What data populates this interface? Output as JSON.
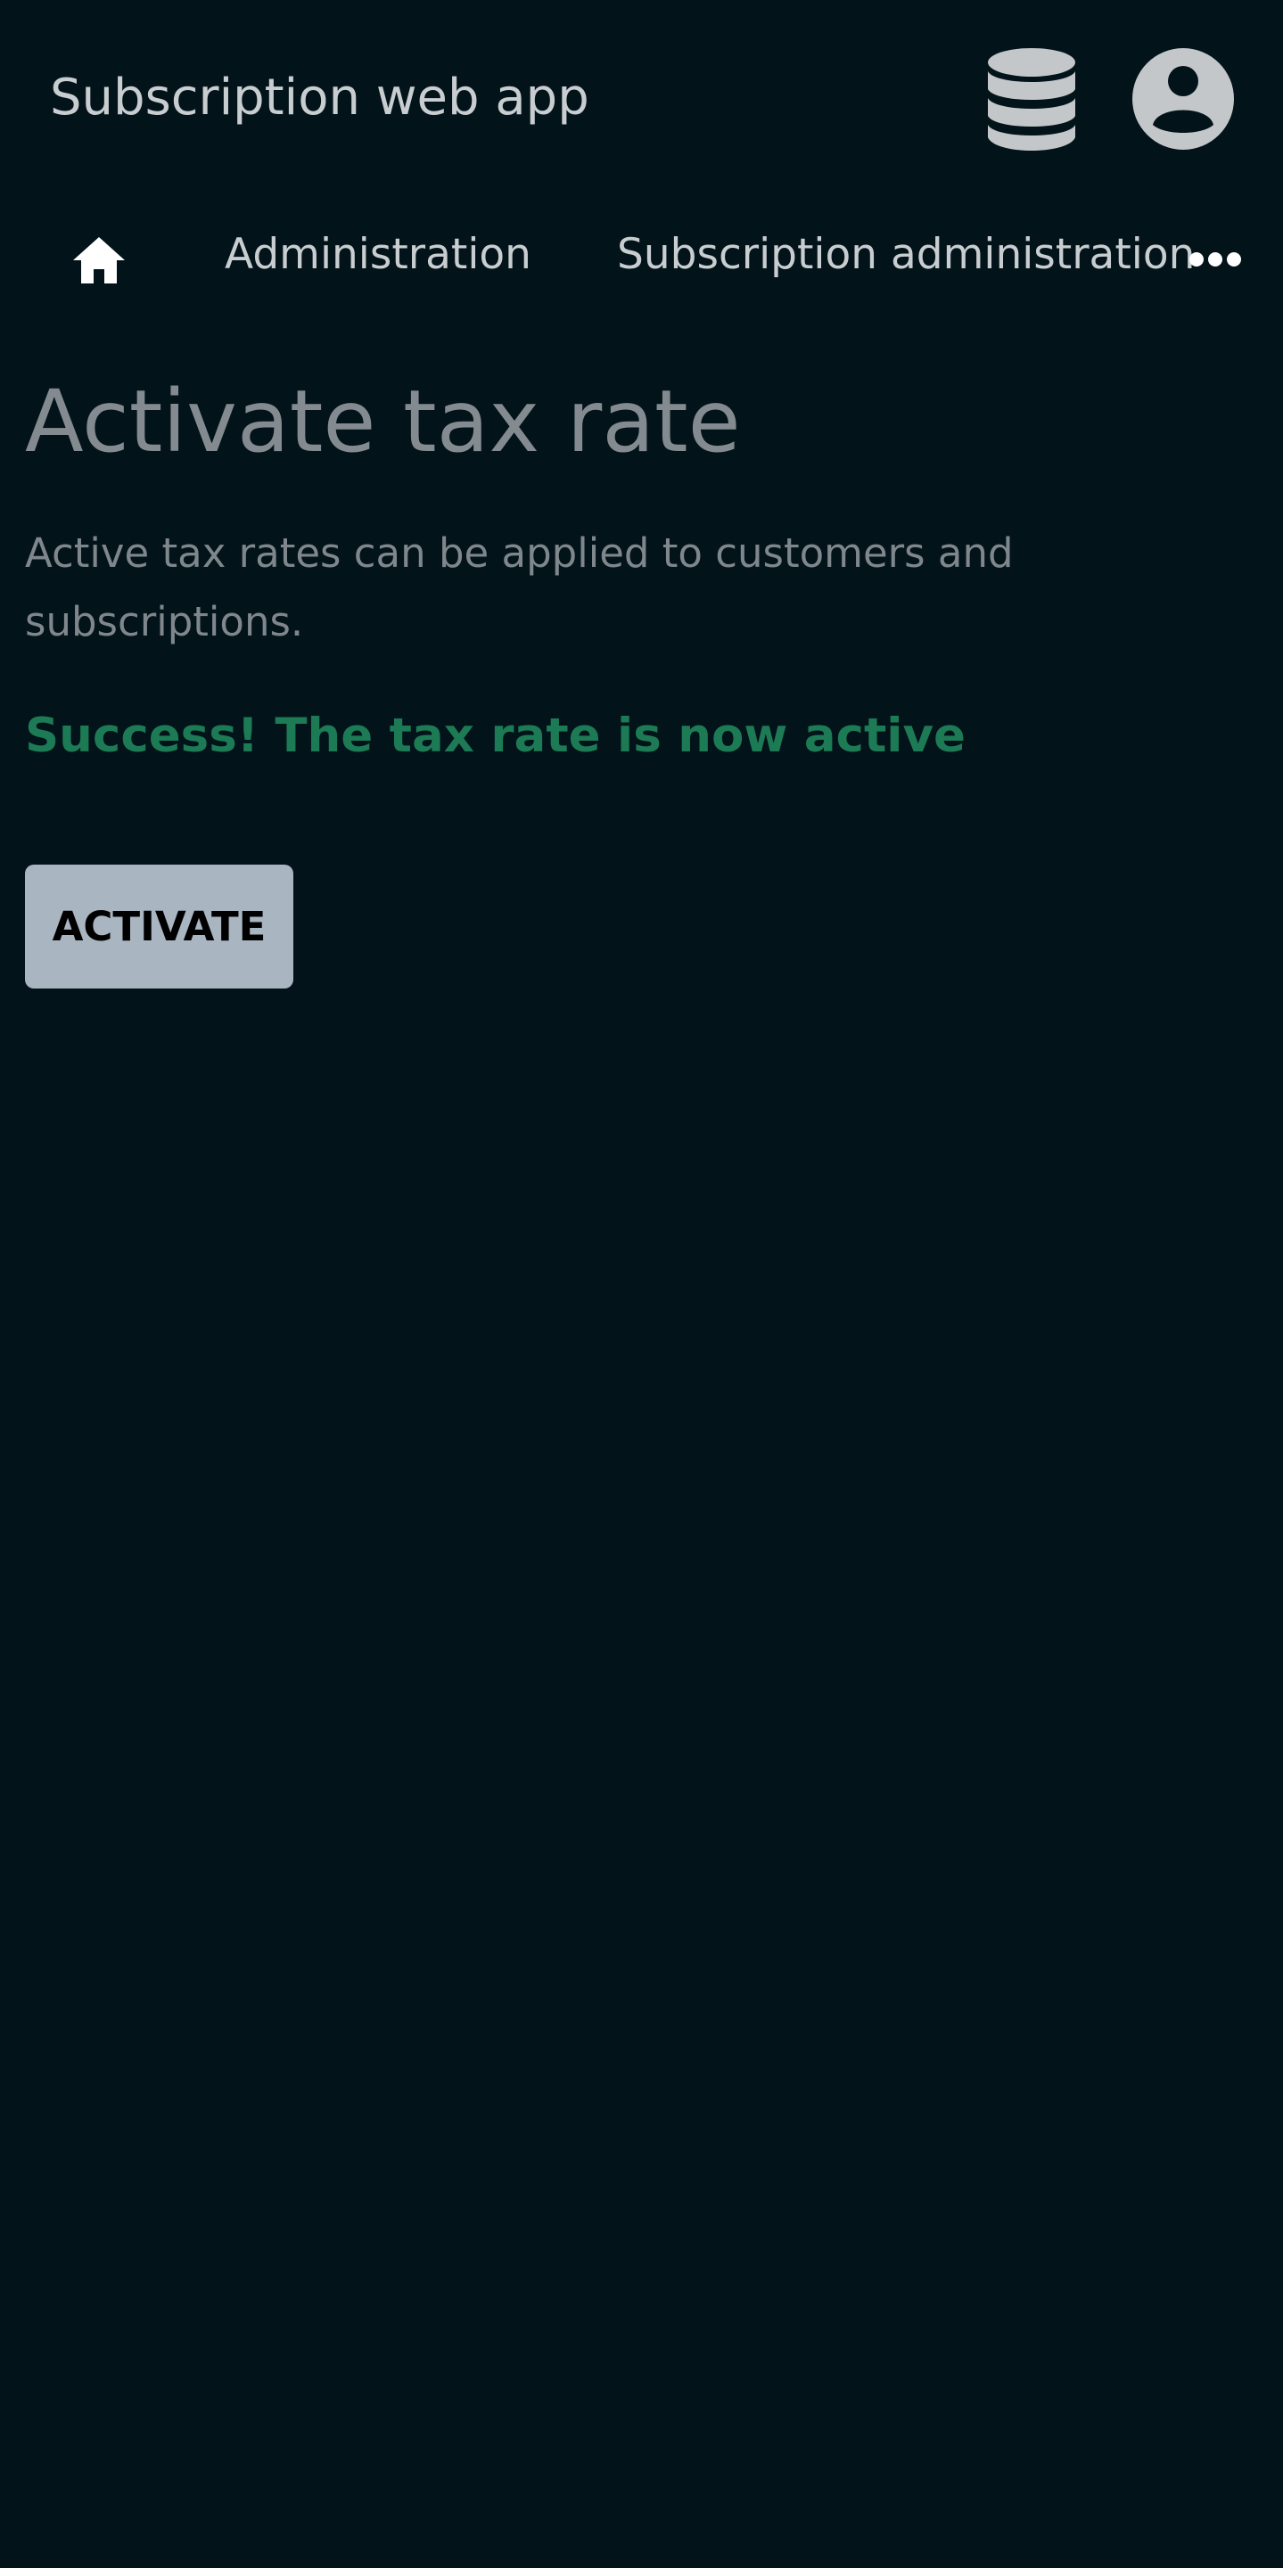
{
  "header": {
    "app_title": "Subscription web app",
    "icons": {
      "database": "database-icon",
      "account": "account-circle-icon"
    }
  },
  "breadcrumb": {
    "home_icon": "home-icon",
    "items": [
      {
        "label": "Administration"
      },
      {
        "label": "Subscription administration"
      }
    ],
    "more_icon": "more-horizontal-icon"
  },
  "main": {
    "title": "Activate tax rate",
    "description": "Active tax rates can be applied to customers and subscriptions.",
    "success_message": "Success! The tax rate is now active",
    "activate_label": "ACTIVATE"
  },
  "colors": {
    "background": "#02131a",
    "header_text": "#c8cdd0",
    "title_text": "#848b90",
    "success": "#1c7a55",
    "button_bg": "#a9b5c1"
  }
}
